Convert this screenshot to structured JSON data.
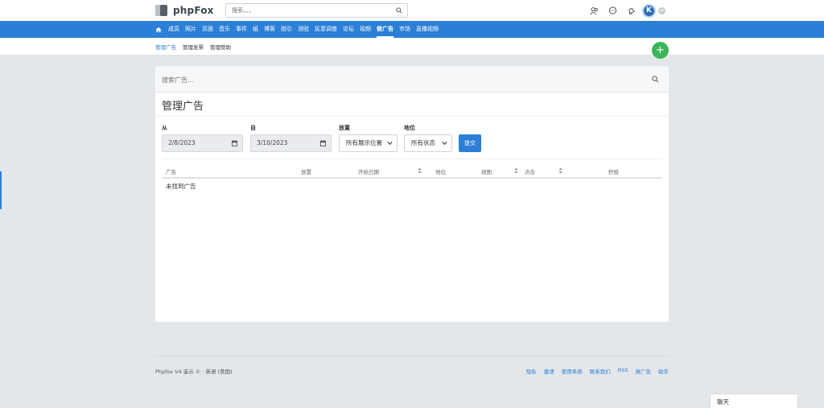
{
  "brand": {
    "logo_text": "phpFox"
  },
  "header": {
    "search_placeholder": "搜索。。。",
    "avatar_letter": "K"
  },
  "nav": {
    "items": [
      "成员",
      "照片",
      "页面",
      "音乐",
      "事件",
      "组",
      "博客",
      "指引",
      "测验",
      "民意调查",
      "论坛",
      "视频",
      "做广告",
      "市场",
      "直播视频"
    ],
    "active": "做广告"
  },
  "subnav": {
    "items": [
      "管理广告",
      "管理发票",
      "管理赞助"
    ],
    "active": "管理广告"
  },
  "fab": {
    "label": "+"
  },
  "card": {
    "search_placeholder": "搜索广告...",
    "title": "管理广告",
    "filters": {
      "from_label": "从",
      "from_value": "2/8/2023",
      "to_label": "自",
      "to_value": "3/10/2023",
      "placement_label": "放置",
      "placement_value": "所有展示位置",
      "status_label": "地位",
      "status_value": "所有状态",
      "submit_label": "提交"
    },
    "table": {
      "columns": [
        "广告",
        "放置",
        "开始日期",
        "地位",
        "视图",
        "点击",
        "积极"
      ],
      "empty_text": "未找到广告"
    }
  },
  "footer": {
    "left": "Phpfox V4 遥示 © · 英语 (美国)",
    "links": [
      "隐私",
      "邀请",
      "使用条款",
      "联系我们",
      "RSS",
      "做广告",
      "助手"
    ]
  },
  "chat": {
    "label": "聊天"
  },
  "colors": {
    "primary": "#2b7fd6",
    "fab": "#3cb55a",
    "background": "#e4e7ea"
  }
}
